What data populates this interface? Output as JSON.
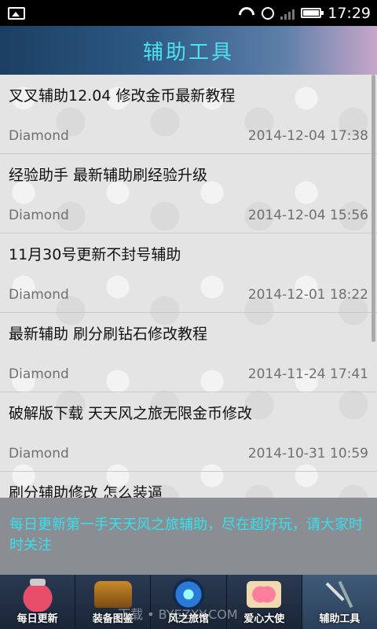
{
  "status_bar": {
    "time": "17:29",
    "icons": [
      "image-icon",
      "wifi-icon",
      "sim-icon",
      "signal-icon",
      "battery-icon"
    ]
  },
  "header": {
    "title": "辅助工具"
  },
  "list": {
    "items": [
      {
        "title": "叉叉辅助12.04  修改金币最新教程",
        "author": "Diamond",
        "date": "2014-12-04 17:38"
      },
      {
        "title": "经验助手 最新辅助刷经验升级",
        "author": "Diamond",
        "date": "2014-12-04 15:56"
      },
      {
        "title": "11月30号更新不封号辅助",
        "author": "Diamond",
        "date": "2014-12-01 18:22"
      },
      {
        "title": "最新辅助 刷分刷钻石修改教程",
        "author": "Diamond",
        "date": "2014-11-24 17:41"
      },
      {
        "title": "破解版下载 天天风之旅无限金币修改",
        "author": "Diamond",
        "date": "2014-10-31 10:59"
      },
      {
        "title": "刷分辅助修改 怎么装逼",
        "author": "",
        "date": ""
      }
    ]
  },
  "banner": {
    "text": "每日更新第一手天天风之旅辅助，尽在超好玩，请大家时时关注"
  },
  "nav": {
    "items": [
      {
        "label": "每日更新",
        "icon": "jar-icon"
      },
      {
        "label": "装备图鉴",
        "icon": "chest-icon"
      },
      {
        "label": "风之旅馆",
        "icon": "orb-icon"
      },
      {
        "label": "爱心大使",
        "icon": "heart-icon"
      },
      {
        "label": "辅助工具",
        "icon": "tools-icon"
      }
    ],
    "active_index": 4
  },
  "watermark": "下载 • BYEZXY.COM",
  "colors": {
    "title_accent": "#4fe0f2",
    "banner_text": "#35e0ef"
  }
}
